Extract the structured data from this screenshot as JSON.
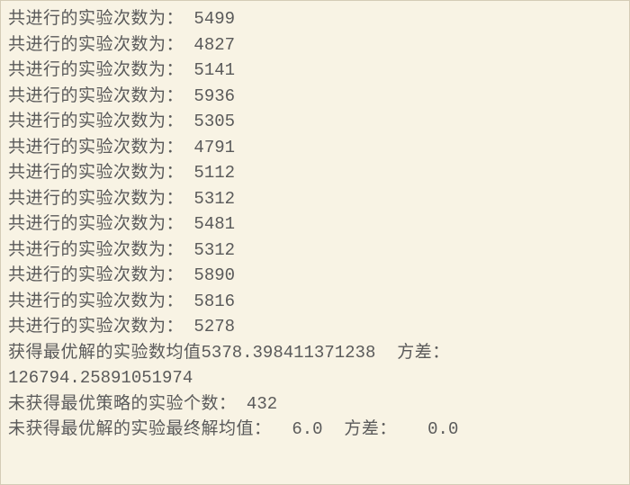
{
  "trial_label": "共进行的实验次数为：",
  "trials": [
    "5499",
    "4827",
    "5141",
    "5936",
    "5305",
    "4791",
    "5112",
    "5312",
    "5481",
    "5312",
    "5890",
    "5816",
    "5278"
  ],
  "summary": {
    "optimal_mean_prefix": "获得最优解的实验数均值",
    "optimal_mean": "5378.398411371238",
    "variance_label": "方差：",
    "optimal_variance": "126794.25891051974",
    "non_optimal_count_label": "未获得最优策略的实验个数：",
    "non_optimal_count": "432",
    "non_optimal_final_label": "未获得最优解的实验最终解均值：",
    "non_optimal_mean": " 6.0",
    "variance_label2": "方差：",
    "non_optimal_variance": "  0.0"
  }
}
